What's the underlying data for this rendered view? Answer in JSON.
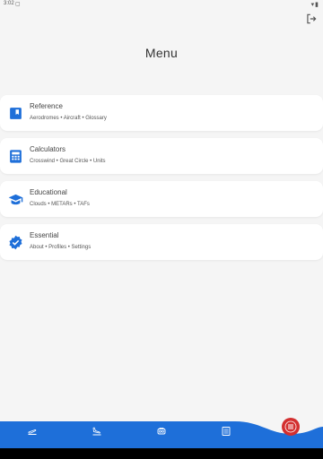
{
  "status": {
    "time": "3:02",
    "notification_icon": "message-icon",
    "right_icons": [
      "wifi-icon",
      "battery-icon"
    ]
  },
  "header": {
    "title": "Menu",
    "logout_icon": "logout-icon"
  },
  "menu": {
    "items": [
      {
        "title": "Reference",
        "subtitle": "Aerodromes • Aircraft • Glossary",
        "icon": "book-icon"
      },
      {
        "title": "Calculators",
        "subtitle": "Crosswind • Great Circle • Units",
        "icon": "calculator-icon"
      },
      {
        "title": "Educational",
        "subtitle": "Clouds • METARs • TAFs",
        "icon": "graduation-cap-icon"
      },
      {
        "title": "Essential",
        "subtitle": "About • Profiles • Settings",
        "icon": "verified-badge-icon"
      }
    ]
  },
  "bottom_nav": {
    "items": [
      {
        "icon": "takeoff-icon"
      },
      {
        "icon": "landing-icon"
      },
      {
        "icon": "engine-icon"
      },
      {
        "icon": "checklist-icon"
      }
    ],
    "fab_icon": "menu-icon"
  },
  "colors": {
    "accent": "#1e6fd9",
    "fab": "#d32f2f",
    "background": "#f5f5f5",
    "card": "#ffffff"
  }
}
